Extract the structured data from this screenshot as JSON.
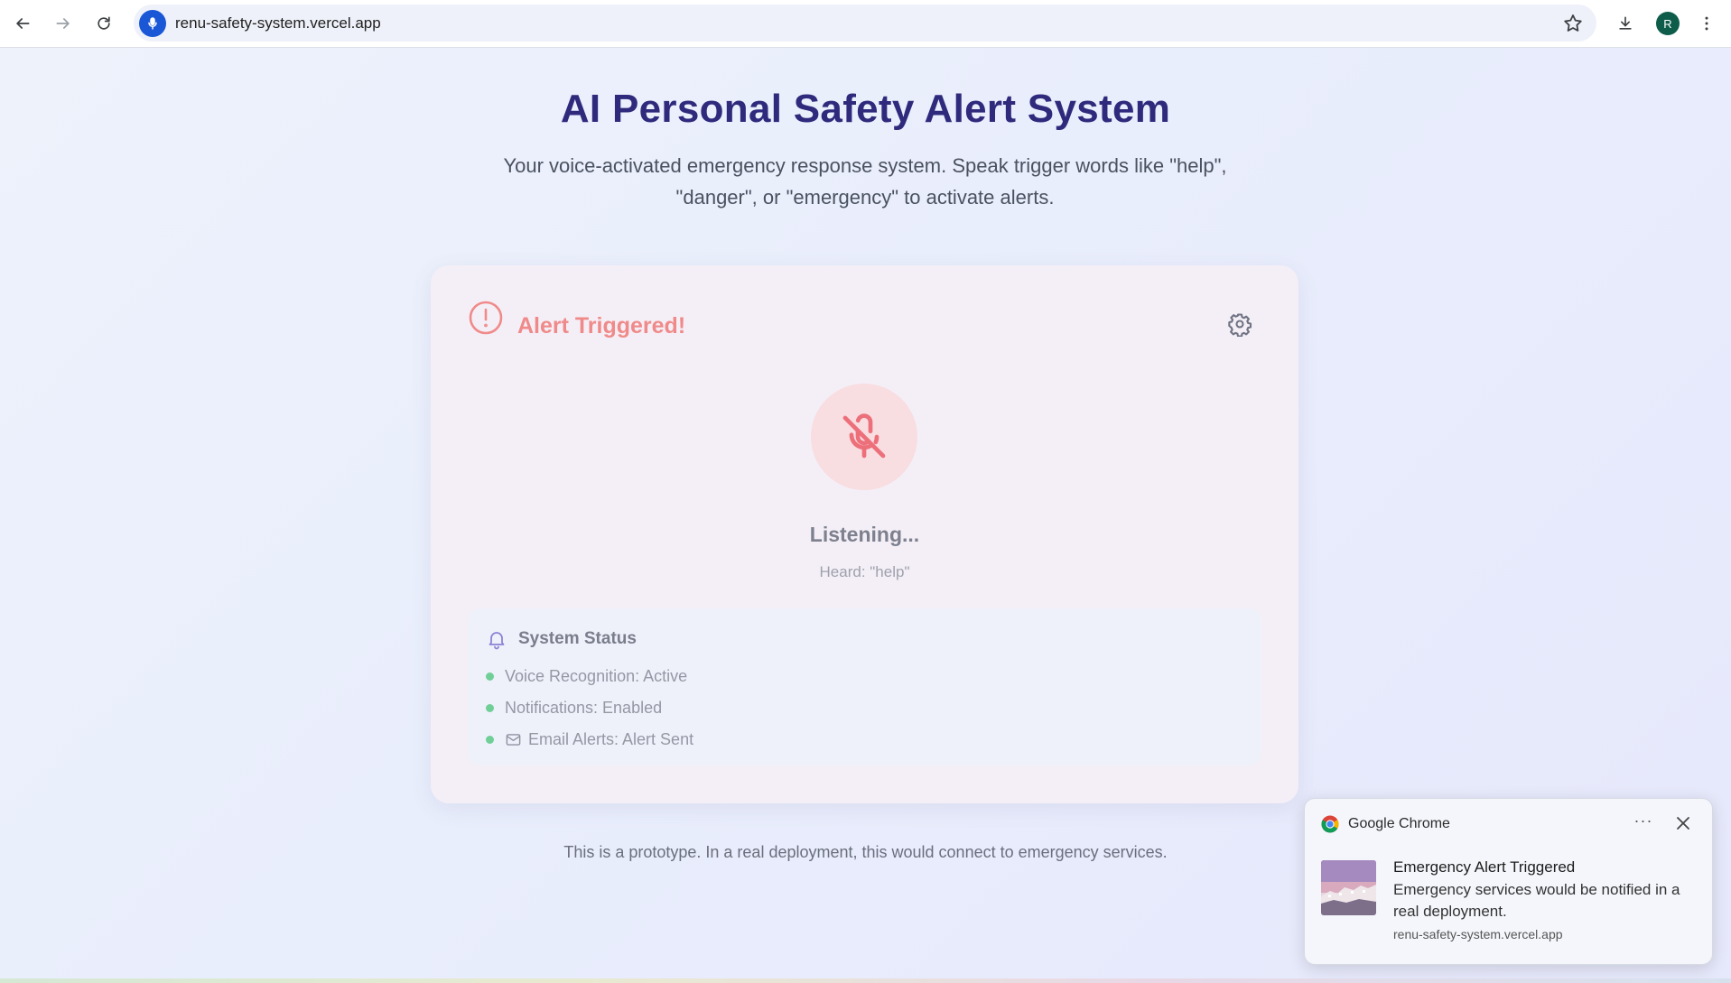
{
  "browser": {
    "url": "renu-safety-system.vercel.app",
    "profile_initial": "R",
    "icons": [
      "back-arrow-icon",
      "forward-arrow-icon",
      "reload-icon",
      "mic-icon",
      "star-icon",
      "download-icon",
      "kebab-menu-icon"
    ]
  },
  "page": {
    "title": "AI Personal Safety Alert System",
    "subtitle": "Your voice-activated emergency response system. Speak trigger words like \"help\", \"danger\", or \"emergency\" to activate alerts.",
    "footer_note": "This is a prototype. In a real deployment, this would connect to emergency services."
  },
  "card": {
    "alert_title": "Alert Triggered!",
    "listening_label": "Listening...",
    "heard_text": "Heard: \"help\"",
    "status": {
      "title": "System Status",
      "items": [
        {
          "label": "Voice Recognition: Active"
        },
        {
          "label": "Notifications: Enabled"
        },
        {
          "label": "Email Alerts: Alert Sent"
        }
      ]
    }
  },
  "notification": {
    "app_name": "Google Chrome",
    "more_label": "···",
    "title": "Emergency Alert Triggered",
    "body": "Emergency services would be notified in a real deployment.",
    "origin": "renu-safety-system.vercel.app"
  },
  "colors": {
    "title": "#302a7d",
    "alert": "#f08a8a",
    "status_dot": "#6fcf97",
    "mic_circle": "#f8dde1"
  }
}
